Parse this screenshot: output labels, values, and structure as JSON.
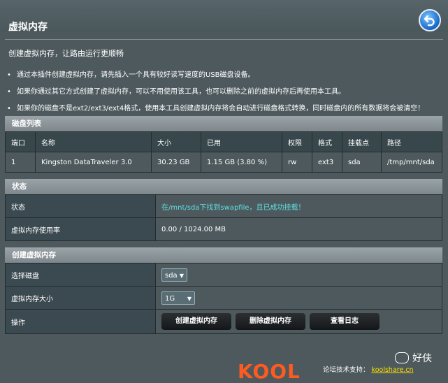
{
  "header": {
    "title": "虚拟内存",
    "back_icon": "back-arrow-icon"
  },
  "subtitle": "创建虚拟内存，让路由运行更顺畅",
  "notes": [
    "通过本插件创建虚拟内存，请先插入一个具有较好读写速度的USB磁盘设备。",
    "如果你通过其它方式创建了虚拟内存，可以不用使用该工具，也可以删除之前的虚拟内存后再使用本工具。",
    "如果你的磁盘不是ext2/ext3/ext4格式，使用本工具创建虚拟内存将会自动进行磁盘格式转换，同时磁盘内的所有数据将会被清空！"
  ],
  "disk_list": {
    "title": "磁盘列表",
    "columns": [
      "端口",
      "名称",
      "大小",
      "已用",
      "权限",
      "格式",
      "挂载点",
      "路径"
    ],
    "rows": [
      [
        "1",
        "Kingston DataTraveler 3.0",
        "30.23 GB",
        "1.15 GB (3.80 %)",
        "rw",
        "ext3",
        "sda",
        "/tmp/mnt/sda"
      ]
    ]
  },
  "status": {
    "title": "状态",
    "status_label": "状态",
    "status_value": "在/mnt/sda下找到swapfile，且已成功挂载！",
    "usage_label": "虚拟内存使用率",
    "usage_value": "0.00 / 1024.00 MB"
  },
  "create": {
    "title": "创建虚拟内存",
    "disk_label": "选择磁盘",
    "disk_value": "sda",
    "size_label": "虚拟内存大小",
    "size_value": "1G",
    "action_label": "操作",
    "buttons": [
      "创建虚拟内存",
      "删除虚拟内存",
      "查看日志"
    ]
  },
  "footer": {
    "logo_text": "KOOL",
    "support_label": "论坛技术支持：",
    "support_link": "koolshare.cn",
    "watermark": "好伕"
  },
  "colors": {
    "background": "#4d595d",
    "status_ok": "#5fe0e3",
    "link": "#ffe000",
    "logo": "#ff5a1f"
  }
}
